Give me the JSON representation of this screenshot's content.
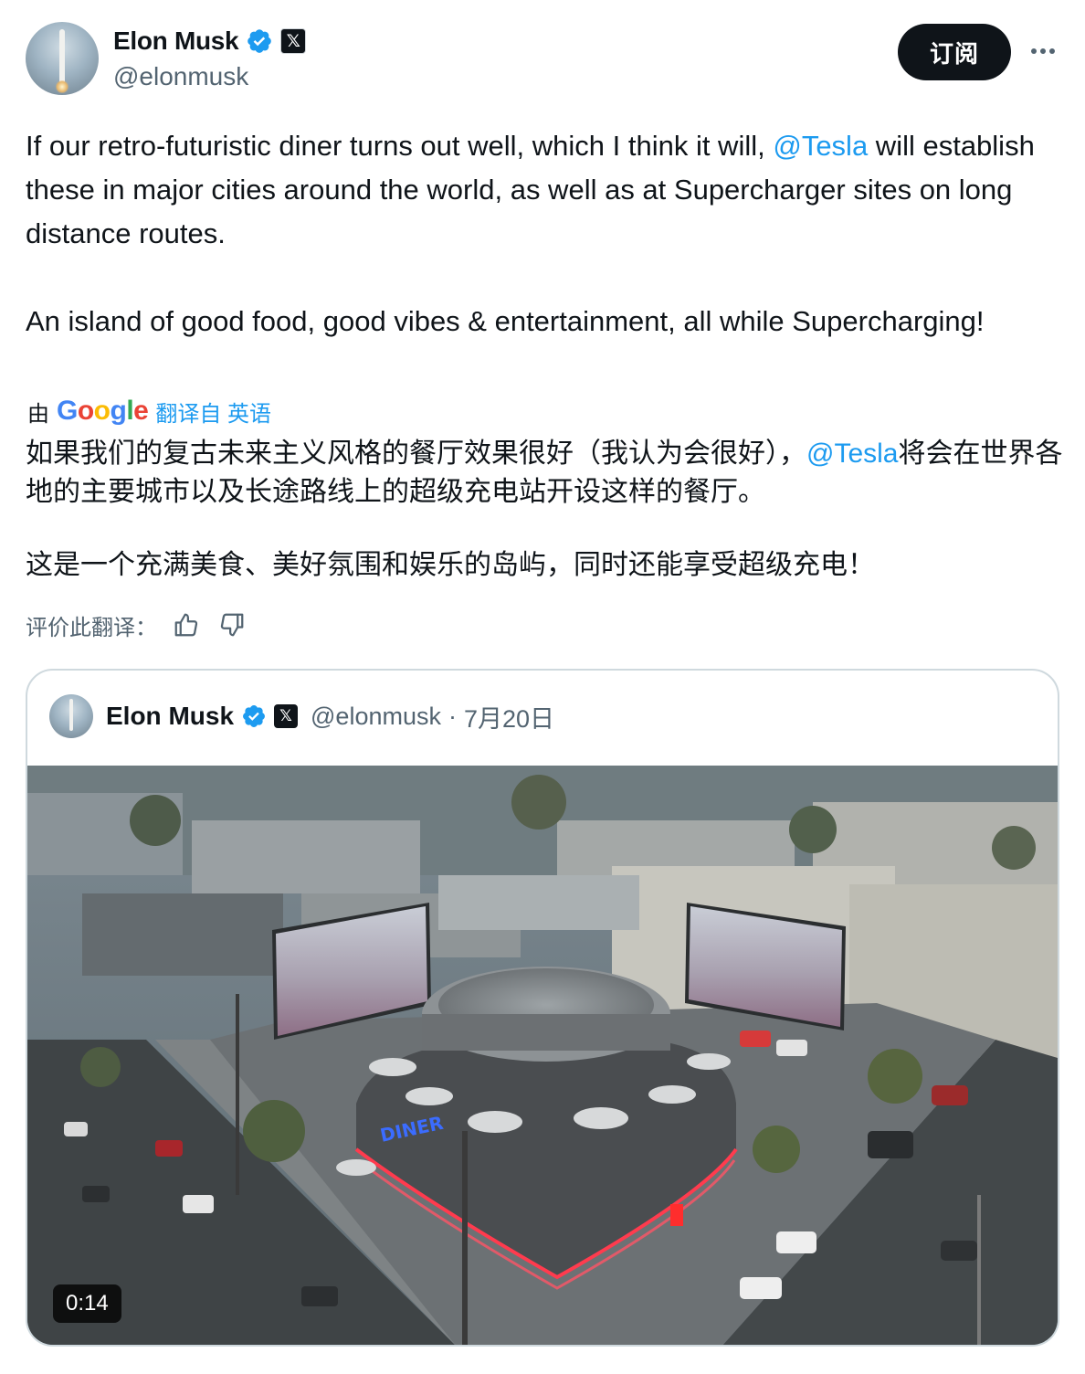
{
  "author": {
    "display_name": "Elon Musk",
    "handle": "@elonmusk",
    "verified_icon": "verified-badge-icon",
    "affiliate_icon": "x-logo-icon",
    "affiliate_glyph": "𝕏"
  },
  "actions": {
    "subscribe_label": "订阅",
    "more_icon": "more-icon"
  },
  "tweet": {
    "para1_before": "If our retro-futuristic diner turns out well, which I think it will, ",
    "mention": "@Tesla",
    "para1_after": " will establish these in major cities around the world, as well as at Supercharger sites on long distance routes.",
    "para2": "An island of good food, good vibes & entertainment, all while Supercharging!"
  },
  "translation": {
    "prefix": "由",
    "provider_logo": "Google",
    "link_label": "翻译自 英语",
    "para1_before": "如果我们的复古未来主义风格的餐厅效果很好（我认为会很好），",
    "mention": "@Tesla",
    "para1_after": "将会在世界各地的主要城市以及长途路线上的超级充电站开设这样的餐厅。",
    "para2": "这是一个充满美食、美好氛围和娱乐的岛屿，同时还能享受超级充电！",
    "rate_label": "评价此翻译：",
    "thumbs_up_icon": "thumbs-up-icon",
    "thumbs_down_icon": "thumbs-down-icon"
  },
  "quoted_tweet": {
    "display_name": "Elon Musk",
    "handle": "@elonmusk",
    "separator": "·",
    "date": "7月20日",
    "x_glyph": "𝕏",
    "media": {
      "type": "video",
      "duration": "0:14",
      "diner_sign": "DINER"
    }
  },
  "colors": {
    "accent": "#1d9bf0",
    "text": "#0f1419",
    "secondary": "#536471",
    "border": "#cfd9de"
  }
}
